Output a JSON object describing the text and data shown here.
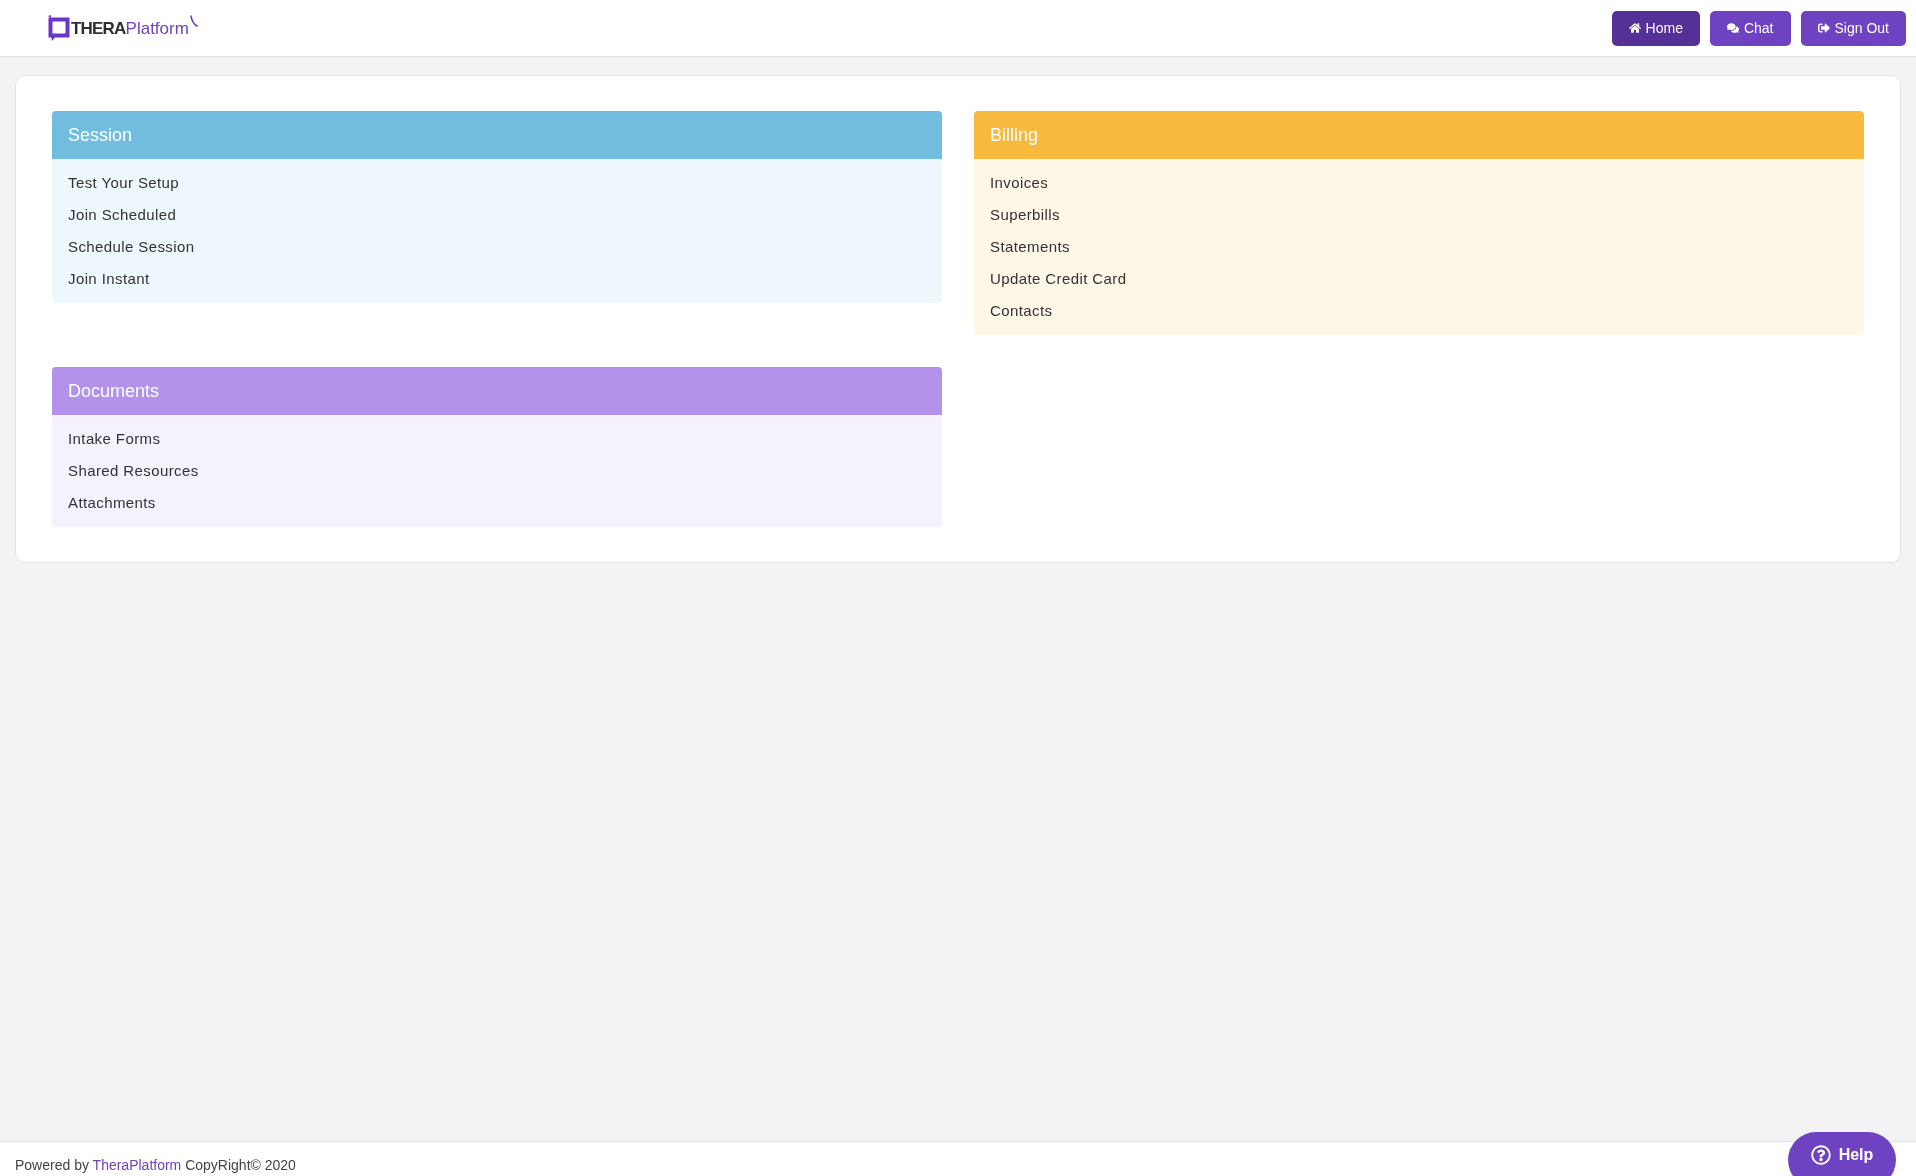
{
  "header": {
    "logo": {
      "bold": "THERA",
      "light": "Platform"
    },
    "nav_buttons": [
      {
        "label": "Home",
        "selected": true
      },
      {
        "label": "Chat",
        "selected": false
      },
      {
        "label": "Sign Out",
        "selected": false
      }
    ]
  },
  "panels": [
    {
      "title": "Session",
      "color": "#72bcdf",
      "items": [
        "Test Your Setup",
        "Join Scheduled",
        "Schedule Session",
        "Join Instant"
      ]
    },
    {
      "title": "Billing",
      "color": "#f7ba3e",
      "items": [
        "Invoices",
        "Superbills",
        "Statements",
        "Update Credit Card",
        "Contacts"
      ]
    },
    {
      "title": "Documents",
      "color": "#b392ec",
      "items": [
        "Intake Forms",
        "Shared Resources",
        "Attachments"
      ]
    }
  ],
  "footer": {
    "text_before": "Powered by",
    "link": "TheraPlatform",
    "text_after": "CopyRight© 2020"
  },
  "help_button": {
    "label": "Help"
  }
}
